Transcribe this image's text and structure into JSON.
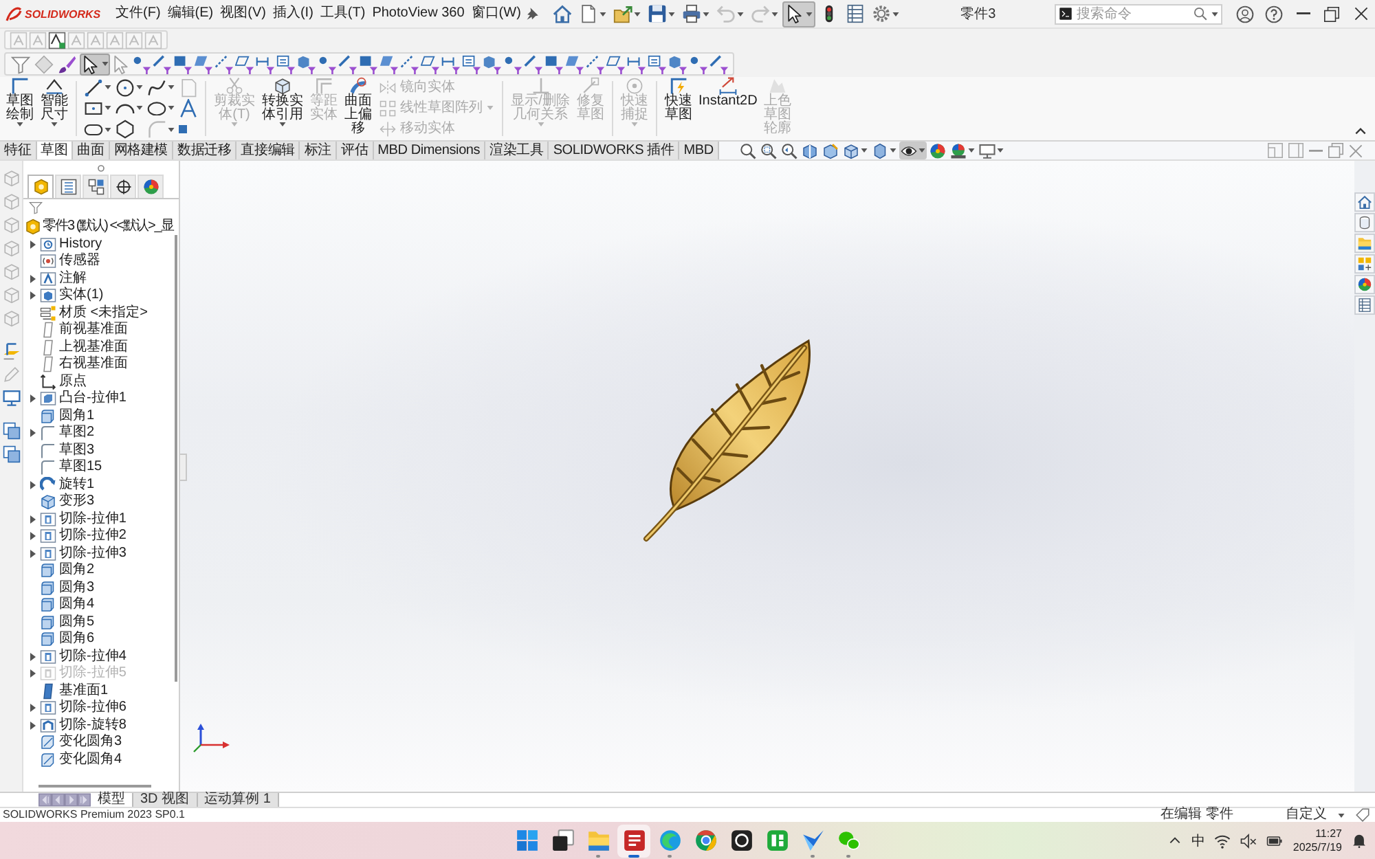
{
  "title_bar": {
    "logo": "SOLIDWORKS",
    "menus": [
      "文件(F)",
      "编辑(E)",
      "视图(V)",
      "插入(I)",
      "工具(T)",
      "PhotoView 360",
      "窗口(W)"
    ],
    "quick_access": [
      {
        "kind": "home",
        "selected": false,
        "disabled": false
      },
      {
        "kind": "new",
        "selected": false,
        "disabled": false
      },
      {
        "kind": "open",
        "selected": false,
        "disabled": false
      },
      {
        "kind": "save",
        "selected": false,
        "disabled": false
      },
      {
        "kind": "print",
        "selected": false,
        "disabled": false
      },
      {
        "kind": "undo",
        "selected": false,
        "disabled": true
      },
      {
        "kind": "redo",
        "selected": false,
        "disabled": true
      },
      {
        "kind": "select",
        "selected": true,
        "disabled": false
      },
      {
        "kind": "rebuild",
        "selected": false,
        "disabled": false
      },
      {
        "kind": "file-properties",
        "selected": false,
        "disabled": false
      },
      {
        "kind": "options",
        "selected": false,
        "disabled": false
      }
    ],
    "document_title": "零件3",
    "search": {
      "placeholder": "搜索命令"
    }
  },
  "selection_filter": {
    "tools": [
      {
        "kind": "funnel",
        "selected": false
      },
      {
        "kind": "hide",
        "selected": false
      },
      {
        "kind": "filter-select",
        "selected": false
      },
      {
        "kind": "select",
        "selected": true
      }
    ]
  },
  "command_manager": {
    "sketch_tools": [
      {
        "label": "草图绘制",
        "disabled": false,
        "dropdown": true
      },
      {
        "label": "智能尺寸",
        "disabled": false,
        "dropdown": true
      }
    ],
    "edit_tools": [
      {
        "label": "剪裁实体(T)",
        "disabled": true,
        "dropdown": true
      },
      {
        "label": "转换实体引用",
        "disabled": false,
        "dropdown": true
      },
      {
        "label": "等距实体",
        "disabled": true,
        "dropdown": false
      },
      {
        "label": "曲面上偏移",
        "disabled": false,
        "dropdown": false
      }
    ],
    "pattern_tools": [
      {
        "label": "镜向实体",
        "disabled": true,
        "dropdown": false
      },
      {
        "label": "线性草图阵列",
        "disabled": true,
        "dropdown": true
      },
      {
        "label": "移动实体",
        "disabled": true,
        "dropdown": false
      }
    ],
    "relation_tools": [
      {
        "label": "显示/删除几何关系",
        "disabled": true,
        "dropdown": true
      },
      {
        "label": "修复草图",
        "disabled": true,
        "dropdown": false
      }
    ],
    "snap_tools": [
      {
        "label": "快速捕捉",
        "disabled": true,
        "dropdown": true
      }
    ],
    "mode_tools": [
      {
        "label": "快速草图",
        "disabled": false,
        "dropdown": false
      },
      {
        "label": "Instant2D",
        "disabled": false,
        "dropdown": false
      },
      {
        "label": "上色草图轮廓",
        "disabled": true,
        "dropdown": false
      }
    ],
    "tabs": [
      {
        "label": "特征",
        "selected": false
      },
      {
        "label": "草图",
        "selected": true
      },
      {
        "label": "曲面",
        "selected": false
      },
      {
        "label": "网格建模",
        "selected": false
      },
      {
        "label": "数据迁移",
        "selected": false
      },
      {
        "label": "直接编辑",
        "selected": false
      },
      {
        "label": "标注",
        "selected": false
      },
      {
        "label": "评估",
        "selected": false
      },
      {
        "label": "MBD Dimensions",
        "selected": false
      },
      {
        "label": "渲染工具",
        "selected": false
      },
      {
        "label": "SOLIDWORKS 插件",
        "selected": false
      },
      {
        "label": "MBD",
        "selected": false
      }
    ]
  },
  "view_toolbar": [
    {
      "kind": "zoom-fit",
      "selected": false
    },
    {
      "kind": "zoom-area",
      "selected": false
    },
    {
      "kind": "previous-view",
      "selected": false
    },
    {
      "kind": "section-view",
      "selected": false
    },
    {
      "kind": "dynamic-annotation",
      "selected": false
    },
    {
      "kind": "view-orientation",
      "selected": false
    },
    {
      "kind": "display-style",
      "selected": false
    },
    {
      "kind": "hide-show",
      "selected": true
    },
    {
      "kind": "edit-appearance",
      "selected": false
    },
    {
      "kind": "apply-scene",
      "selected": false
    },
    {
      "kind": "view-settings",
      "selected": false
    }
  ],
  "feature_tree": {
    "panel_tabs": [
      {
        "kind": "feature-manager",
        "selected": true
      },
      {
        "kind": "property-manager",
        "selected": false
      },
      {
        "kind": "configuration-manager",
        "selected": false
      },
      {
        "kind": "dimxpert-manager",
        "selected": false
      },
      {
        "kind": "display-manager",
        "selected": false
      }
    ],
    "root": "零件3 (默认) <<默认>_显",
    "items": [
      {
        "kind": "history",
        "label": "History",
        "expandable": true,
        "suppressed": false
      },
      {
        "kind": "sensor",
        "label": "传感器",
        "expandable": false,
        "suppressed": false
      },
      {
        "kind": "annotations",
        "label": "注解",
        "expandable": true,
        "suppressed": false
      },
      {
        "kind": "solid-bodies",
        "label": "实体(1)",
        "expandable": true,
        "suppressed": false
      },
      {
        "kind": "material",
        "label": "材质 <未指定>",
        "expandable": false,
        "suppressed": false
      },
      {
        "kind": "plane",
        "label": "前视基准面",
        "expandable": false,
        "suppressed": false
      },
      {
        "kind": "plane",
        "label": "上视基准面",
        "expandable": false,
        "suppressed": false
      },
      {
        "kind": "plane",
        "label": "右视基准面",
        "expandable": false,
        "suppressed": false
      },
      {
        "kind": "origin",
        "label": "原点",
        "expandable": false,
        "suppressed": false
      },
      {
        "kind": "extrude",
        "label": "凸台-拉伸1",
        "expandable": true,
        "suppressed": false
      },
      {
        "kind": "fillet",
        "label": "圆角1",
        "expandable": false,
        "suppressed": false
      },
      {
        "kind": "sketch",
        "label": "草图2",
        "expandable": true,
        "suppressed": false
      },
      {
        "kind": "sketch",
        "label": "草图3",
        "expandable": false,
        "suppressed": false
      },
      {
        "kind": "sketch",
        "label": "草图15",
        "expandable": false,
        "suppressed": false
      },
      {
        "kind": "revolve",
        "label": "旋转1",
        "expandable": true,
        "suppressed": false
      },
      {
        "kind": "deform",
        "label": "变形3",
        "expandable": false,
        "suppressed": false
      },
      {
        "kind": "cut-extrude",
        "label": "切除-拉伸1",
        "expandable": true,
        "suppressed": false
      },
      {
        "kind": "cut-extrude",
        "label": "切除-拉伸2",
        "expandable": true,
        "suppressed": false
      },
      {
        "kind": "cut-extrude",
        "label": "切除-拉伸3",
        "expandable": true,
        "suppressed": false
      },
      {
        "kind": "fillet",
        "label": "圆角2",
        "expandable": false,
        "suppressed": false
      },
      {
        "kind": "fillet",
        "label": "圆角3",
        "expandable": false,
        "suppressed": false
      },
      {
        "kind": "fillet",
        "label": "圆角4",
        "expandable": false,
        "suppressed": false
      },
      {
        "kind": "fillet",
        "label": "圆角5",
        "expandable": false,
        "suppressed": false
      },
      {
        "kind": "fillet",
        "label": "圆角6",
        "expandable": false,
        "suppressed": false
      },
      {
        "kind": "cut-extrude",
        "label": "切除-拉伸4",
        "expandable": true,
        "suppressed": false
      },
      {
        "kind": "cut-extrude",
        "label": "切除-拉伸5",
        "expandable": true,
        "suppressed": true
      },
      {
        "kind": "datum-plane",
        "label": "基准面1",
        "expandable": false,
        "suppressed": false
      },
      {
        "kind": "cut-extrude",
        "label": "切除-拉伸6",
        "expandable": true,
        "suppressed": false
      },
      {
        "kind": "cut-revolve",
        "label": "切除-旋转8",
        "expandable": true,
        "suppressed": false
      },
      {
        "kind": "variable-fillet",
        "label": "变化圆角3",
        "expandable": false,
        "suppressed": false
      },
      {
        "kind": "variable-fillet",
        "label": "变化圆角4",
        "expandable": false,
        "suppressed": false
      }
    ]
  },
  "bottom_tabs": [
    {
      "label": "模型",
      "selected": true
    },
    {
      "label": "3D 视图",
      "selected": false
    },
    {
      "label": "运动算例 1",
      "selected": false
    }
  ],
  "status_bar": {
    "version": "SOLIDWORKS Premium 2023 SP0.1",
    "mode": "在编辑 零件",
    "units": "自定义"
  },
  "taskbar": {
    "apps": [
      {
        "kind": "start",
        "active": false,
        "running": false
      },
      {
        "kind": "task-view",
        "active": false,
        "running": false
      },
      {
        "kind": "file-explorer",
        "active": false,
        "running": true
      },
      {
        "kind": "cad",
        "active": true,
        "running": true
      },
      {
        "kind": "edge",
        "active": false,
        "running": true
      },
      {
        "kind": "chrome",
        "active": false,
        "running": false
      },
      {
        "kind": "dark-app",
        "active": false,
        "running": false
      },
      {
        "kind": "green-app",
        "active": false,
        "running": false
      },
      {
        "kind": "blue-app",
        "active": false,
        "running": true
      },
      {
        "kind": "chat",
        "active": false,
        "running": true
      }
    ],
    "ime": "中",
    "time": "11:27",
    "date": "2025/7/19"
  }
}
